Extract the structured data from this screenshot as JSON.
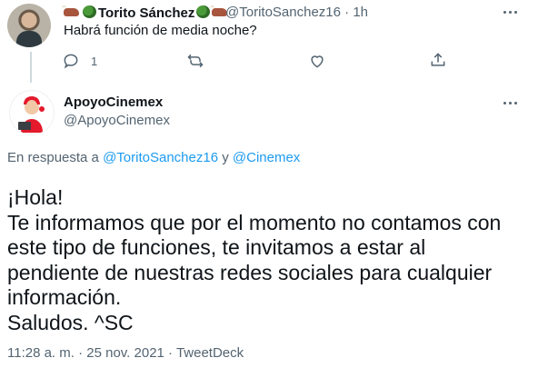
{
  "original_tweet": {
    "display_name": "Torito Sánchez",
    "handle": "@ToritoSanchez16",
    "separator": "·",
    "time": "1h",
    "text": "Habrá función de media noche?",
    "reply_count": "1"
  },
  "reply_tweet": {
    "display_name": "ApoyoCinemex",
    "handle": "@ApoyoCinemex",
    "in_reply_prefix": "En respuesta a",
    "in_reply_user1": "@ToritoSanchez16",
    "in_reply_and": "y",
    "in_reply_user2": "@Cinemex",
    "body": "¡Hola!\nTe informamos que por el momento no contamos con\neste tipo de funciones, te invitamos a estar al\npendiente de nuestras redes sociales para cualquier\ninformación.\nSaludos. ^SC",
    "meta": "11:28 a. m. · 25 nov. 2021 · TweetDeck"
  },
  "icons": [
    "reply-icon",
    "retweet-icon",
    "like-icon",
    "share-icon",
    "more-icon",
    "ox-emoji",
    "broccoli-emoji"
  ],
  "colors": {
    "text": "#0f1419",
    "secondary": "#536471",
    "link": "#1d9bf0",
    "brand_red": "#e4192b"
  }
}
